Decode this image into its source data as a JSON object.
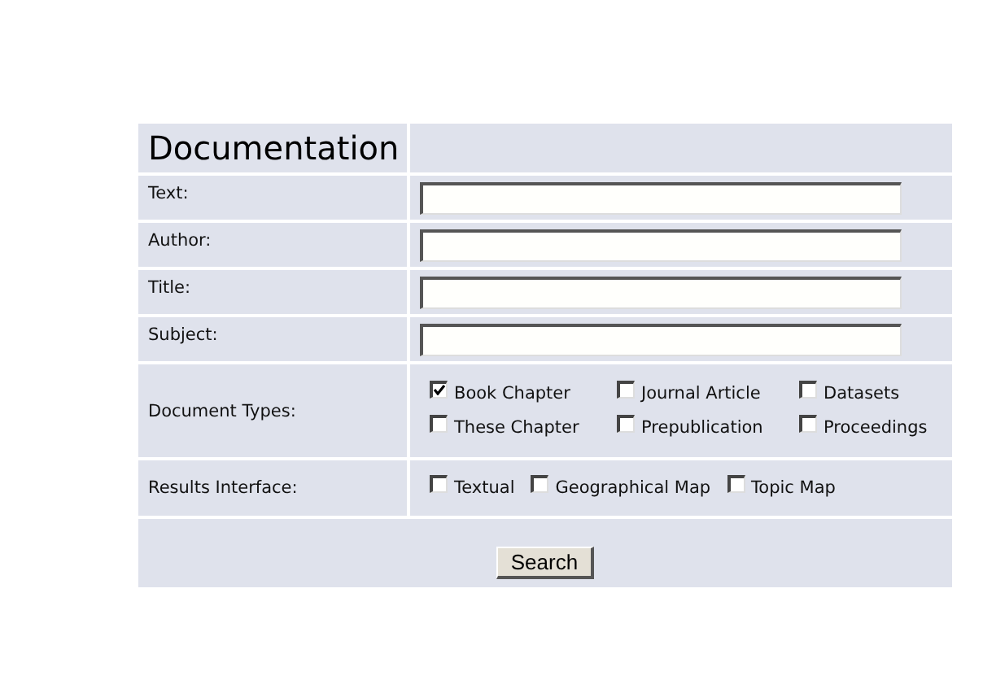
{
  "form": {
    "title": "Documentation",
    "fields": [
      {
        "label": "Text:"
      },
      {
        "label": "Author:"
      },
      {
        "label": "Title:"
      },
      {
        "label": "Subject:"
      }
    ],
    "groups": [
      {
        "label": "Document Types:",
        "options": [
          {
            "label": "Book Chapter",
            "checked": true
          },
          {
            "label": "Journal Article",
            "checked": false
          },
          {
            "label": "Datasets",
            "checked": false
          },
          {
            "label": "These Chapter",
            "checked": false
          },
          {
            "label": "Prepublication",
            "checked": false
          },
          {
            "label": "Proceedings",
            "checked": false
          }
        ]
      },
      {
        "label": "Results Interface:",
        "options": [
          {
            "label": "Textual",
            "checked": false
          },
          {
            "label": "Geographical Map",
            "checked": false
          },
          {
            "label": "Topic Map",
            "checked": false
          }
        ]
      }
    ],
    "button": "Search"
  }
}
